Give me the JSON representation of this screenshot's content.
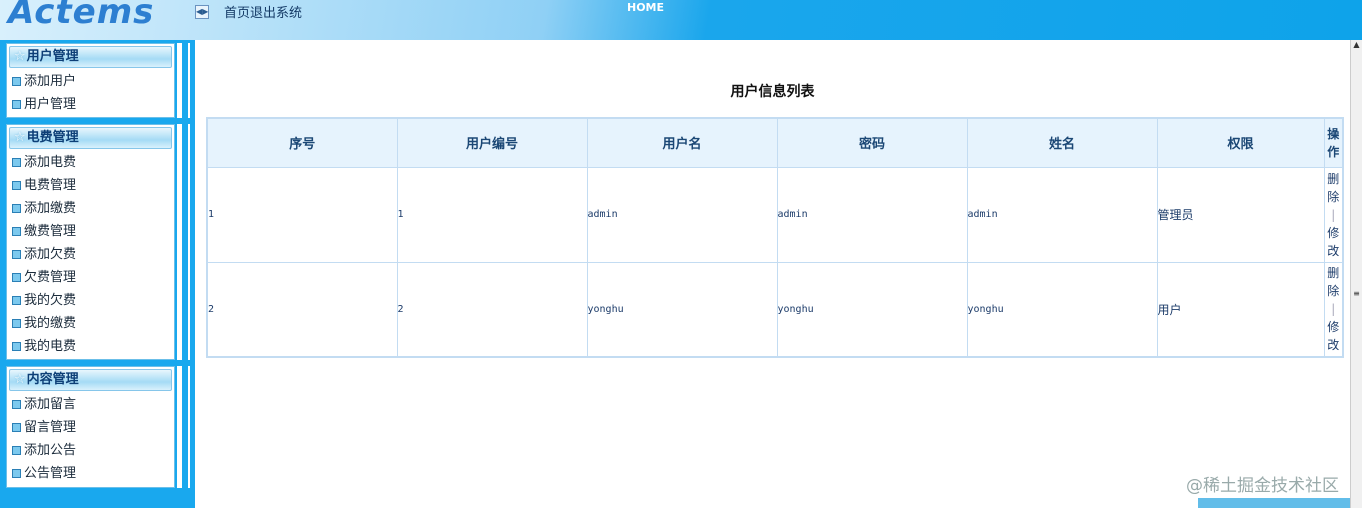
{
  "header": {
    "logo": "Actems",
    "nav": "首页退出系统",
    "home": "HOME"
  },
  "sidebar": [
    {
      "title": "用户管理",
      "items": [
        "添加用户",
        "用户管理"
      ]
    },
    {
      "title": "电费管理",
      "items": [
        "添加电费",
        "电费管理",
        "添加缴费",
        "缴费管理",
        "添加欠费",
        "欠费管理",
        "我的欠费",
        "我的缴费",
        "我的电费"
      ]
    },
    {
      "title": "内容管理",
      "items": [
        "添加留言",
        "留言管理",
        "添加公告",
        "公告管理"
      ]
    }
  ],
  "main": {
    "title": "用户信息列表",
    "columns": [
      "序号",
      "用户编号",
      "用户名",
      "密码",
      "姓名",
      "权限",
      "操作"
    ],
    "rows": [
      {
        "no": "1",
        "id": "1",
        "username": "admin",
        "password": "admin",
        "name": "admin",
        "role": "管理员"
      },
      {
        "no": "2",
        "id": "2",
        "username": "yonghu",
        "password": "yonghu",
        "name": "yonghu",
        "role": "用户"
      }
    ],
    "delete_label": "删除",
    "edit_label": "修改",
    "sep": "|"
  },
  "watermark": "@稀土掘金技术社区"
}
